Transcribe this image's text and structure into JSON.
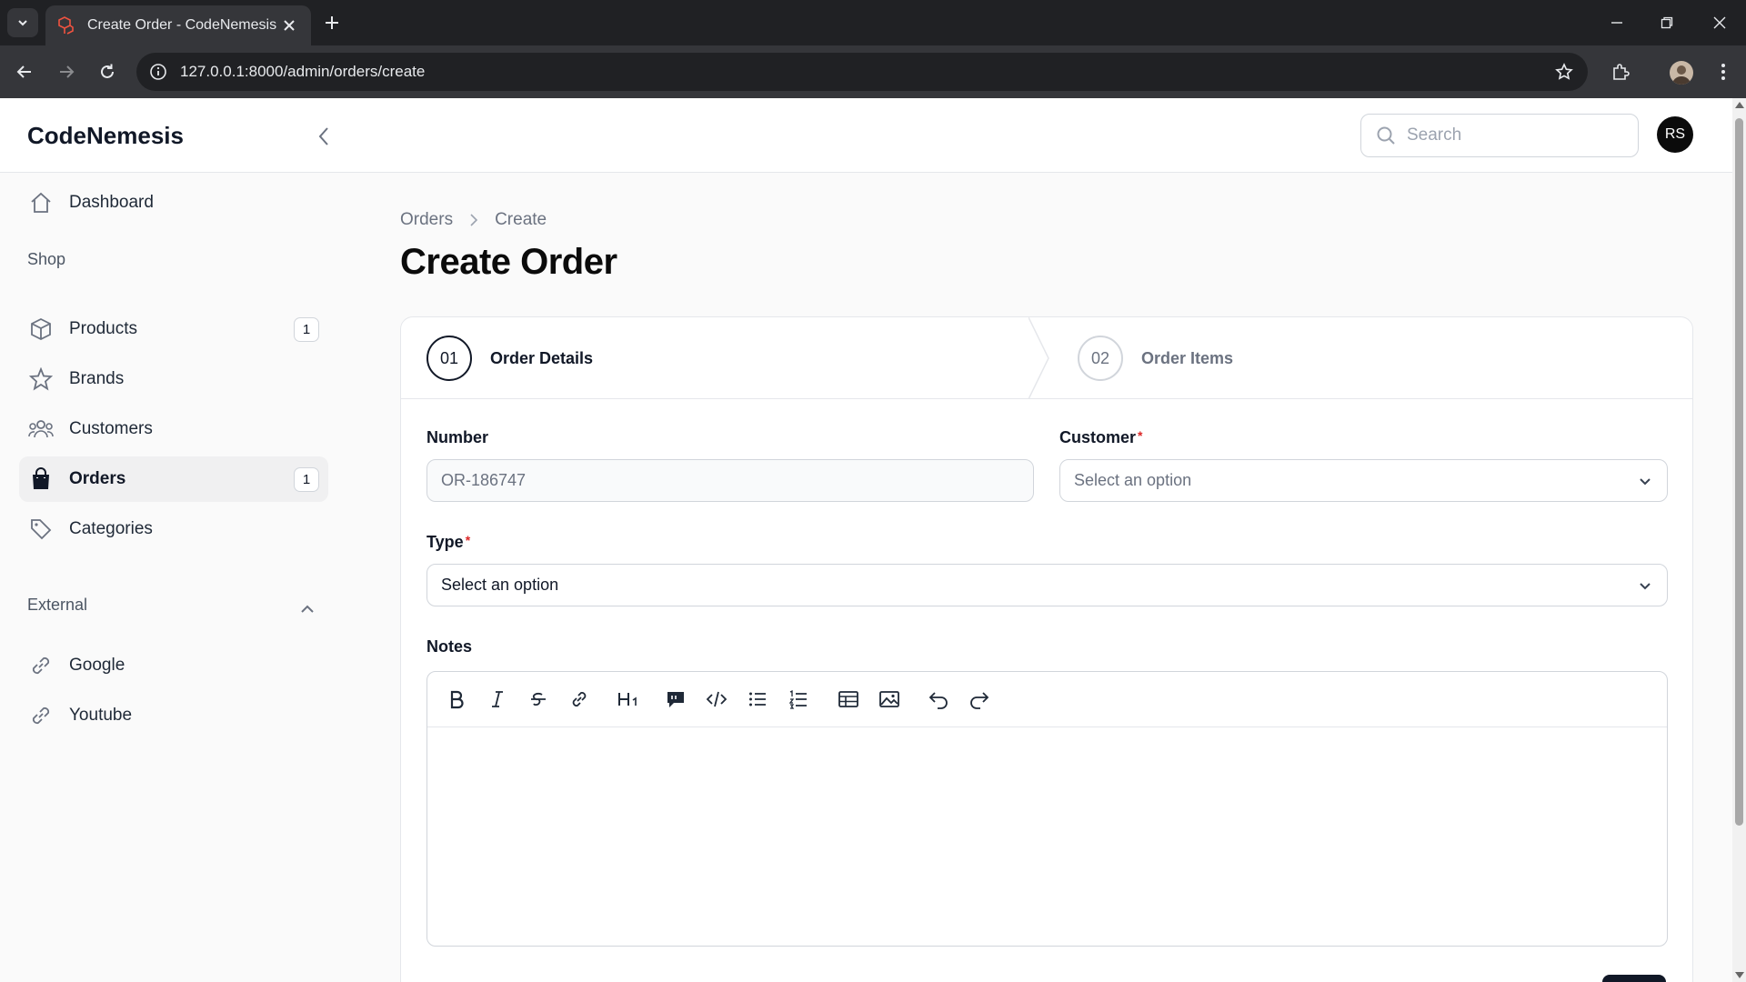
{
  "browser": {
    "tab_title": "Create Order - CodeNemesis",
    "url": "127.0.0.1:8000/admin/orders/create"
  },
  "header": {
    "brand": "CodeNemesis",
    "search_placeholder": "Search",
    "user_initials": "RS"
  },
  "sidebar": {
    "dashboard": "Dashboard",
    "group_shop": "Shop",
    "products": "Products",
    "products_badge": "1",
    "brands": "Brands",
    "customers": "Customers",
    "orders": "Orders",
    "orders_badge": "1",
    "categories": "Categories",
    "group_external": "External",
    "google": "Google",
    "youtube": "Youtube"
  },
  "breadcrumb": {
    "parent": "Orders",
    "current": "Create"
  },
  "page": {
    "title": "Create Order"
  },
  "wizard": {
    "step1_num": "01",
    "step1_label": "Order Details",
    "step2_num": "02",
    "step2_label": "Order Items"
  },
  "form": {
    "number_label": "Number",
    "number_value": "OR-186747",
    "customer_label": "Customer",
    "customer_placeholder": "Select an option",
    "type_label": "Type",
    "type_value": "Select an option",
    "notes_label": "Notes",
    "required_mark": "*"
  },
  "colors": {
    "accent": "#111827",
    "required": "#dc2626",
    "chrome_dark": "#202124",
    "chrome_mid": "#35363a"
  }
}
